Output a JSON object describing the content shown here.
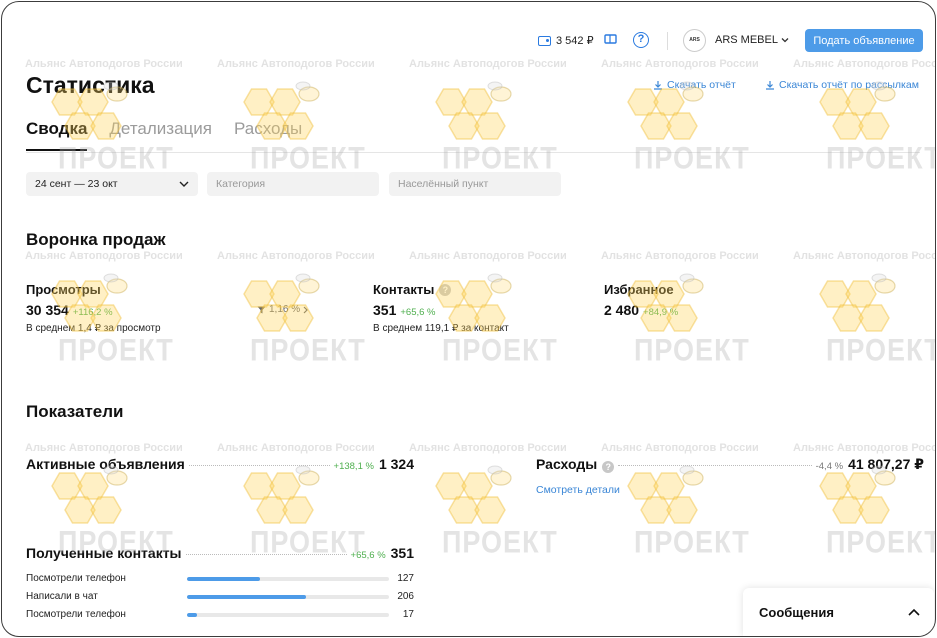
{
  "header": {
    "wallet_balance": "3 542 ₽",
    "user_name": "ARS MEBEL",
    "avatar_text": "ARS",
    "post_ad_label": "Подать объявление"
  },
  "page": {
    "title": "Статистика",
    "download_report": "Скачать отчёт",
    "download_mailing": "Скачать отчёт по рассылкам",
    "tabs": [
      {
        "label": "Сводка",
        "active": true
      },
      {
        "label": "Детализация",
        "active": false
      },
      {
        "label": "Расходы",
        "active": false
      }
    ]
  },
  "filters": {
    "date_range": "24 сент — 23 окт",
    "category_placeholder": "Категория",
    "city_placeholder": "Населённый пункт"
  },
  "funnel": {
    "heading": "Воронка продаж",
    "views": {
      "label": "Просмотры",
      "value": "30 354",
      "delta": "+116,2 %",
      "sub": "В среднем 1,4 ₽ за просмотр"
    },
    "conversion": "1,16 %",
    "contacts": {
      "label": "Контакты",
      "value": "351",
      "delta": "+65,6 %",
      "sub": "В среднем 119,1 ₽ за контакт"
    },
    "favorites": {
      "label": "Избранное",
      "value": "2 480",
      "delta": "+84,9 %"
    }
  },
  "indicators": {
    "heading": "Показатели",
    "active_ads": {
      "label": "Активные объявления",
      "delta": "+138,1 %",
      "value": "1 324"
    },
    "expenses": {
      "label": "Расходы",
      "delta": "-4,4 %",
      "value": "41 807,27 ₽",
      "link": "Смотреть детали"
    },
    "received_contacts": {
      "label": "Полученные контакты",
      "delta": "+65,6 %",
      "value": "351",
      "items": [
        {
          "label": "Посмотрели телефон",
          "value": "127",
          "fraction": 0.36
        },
        {
          "label": "Написали в чат",
          "value": "206",
          "fraction": 0.59
        },
        {
          "label": "Посмотрели телефон",
          "value": "17",
          "fraction": 0.05
        }
      ]
    }
  },
  "messages": {
    "label": "Сообщения"
  },
  "watermark": {
    "caption": "Альянс Автоподогов России",
    "text": "ПРОЕКТ"
  },
  "colors": {
    "accent": "#4d9be8",
    "link": "#3a86d6",
    "positive": "#4faf4f"
  }
}
